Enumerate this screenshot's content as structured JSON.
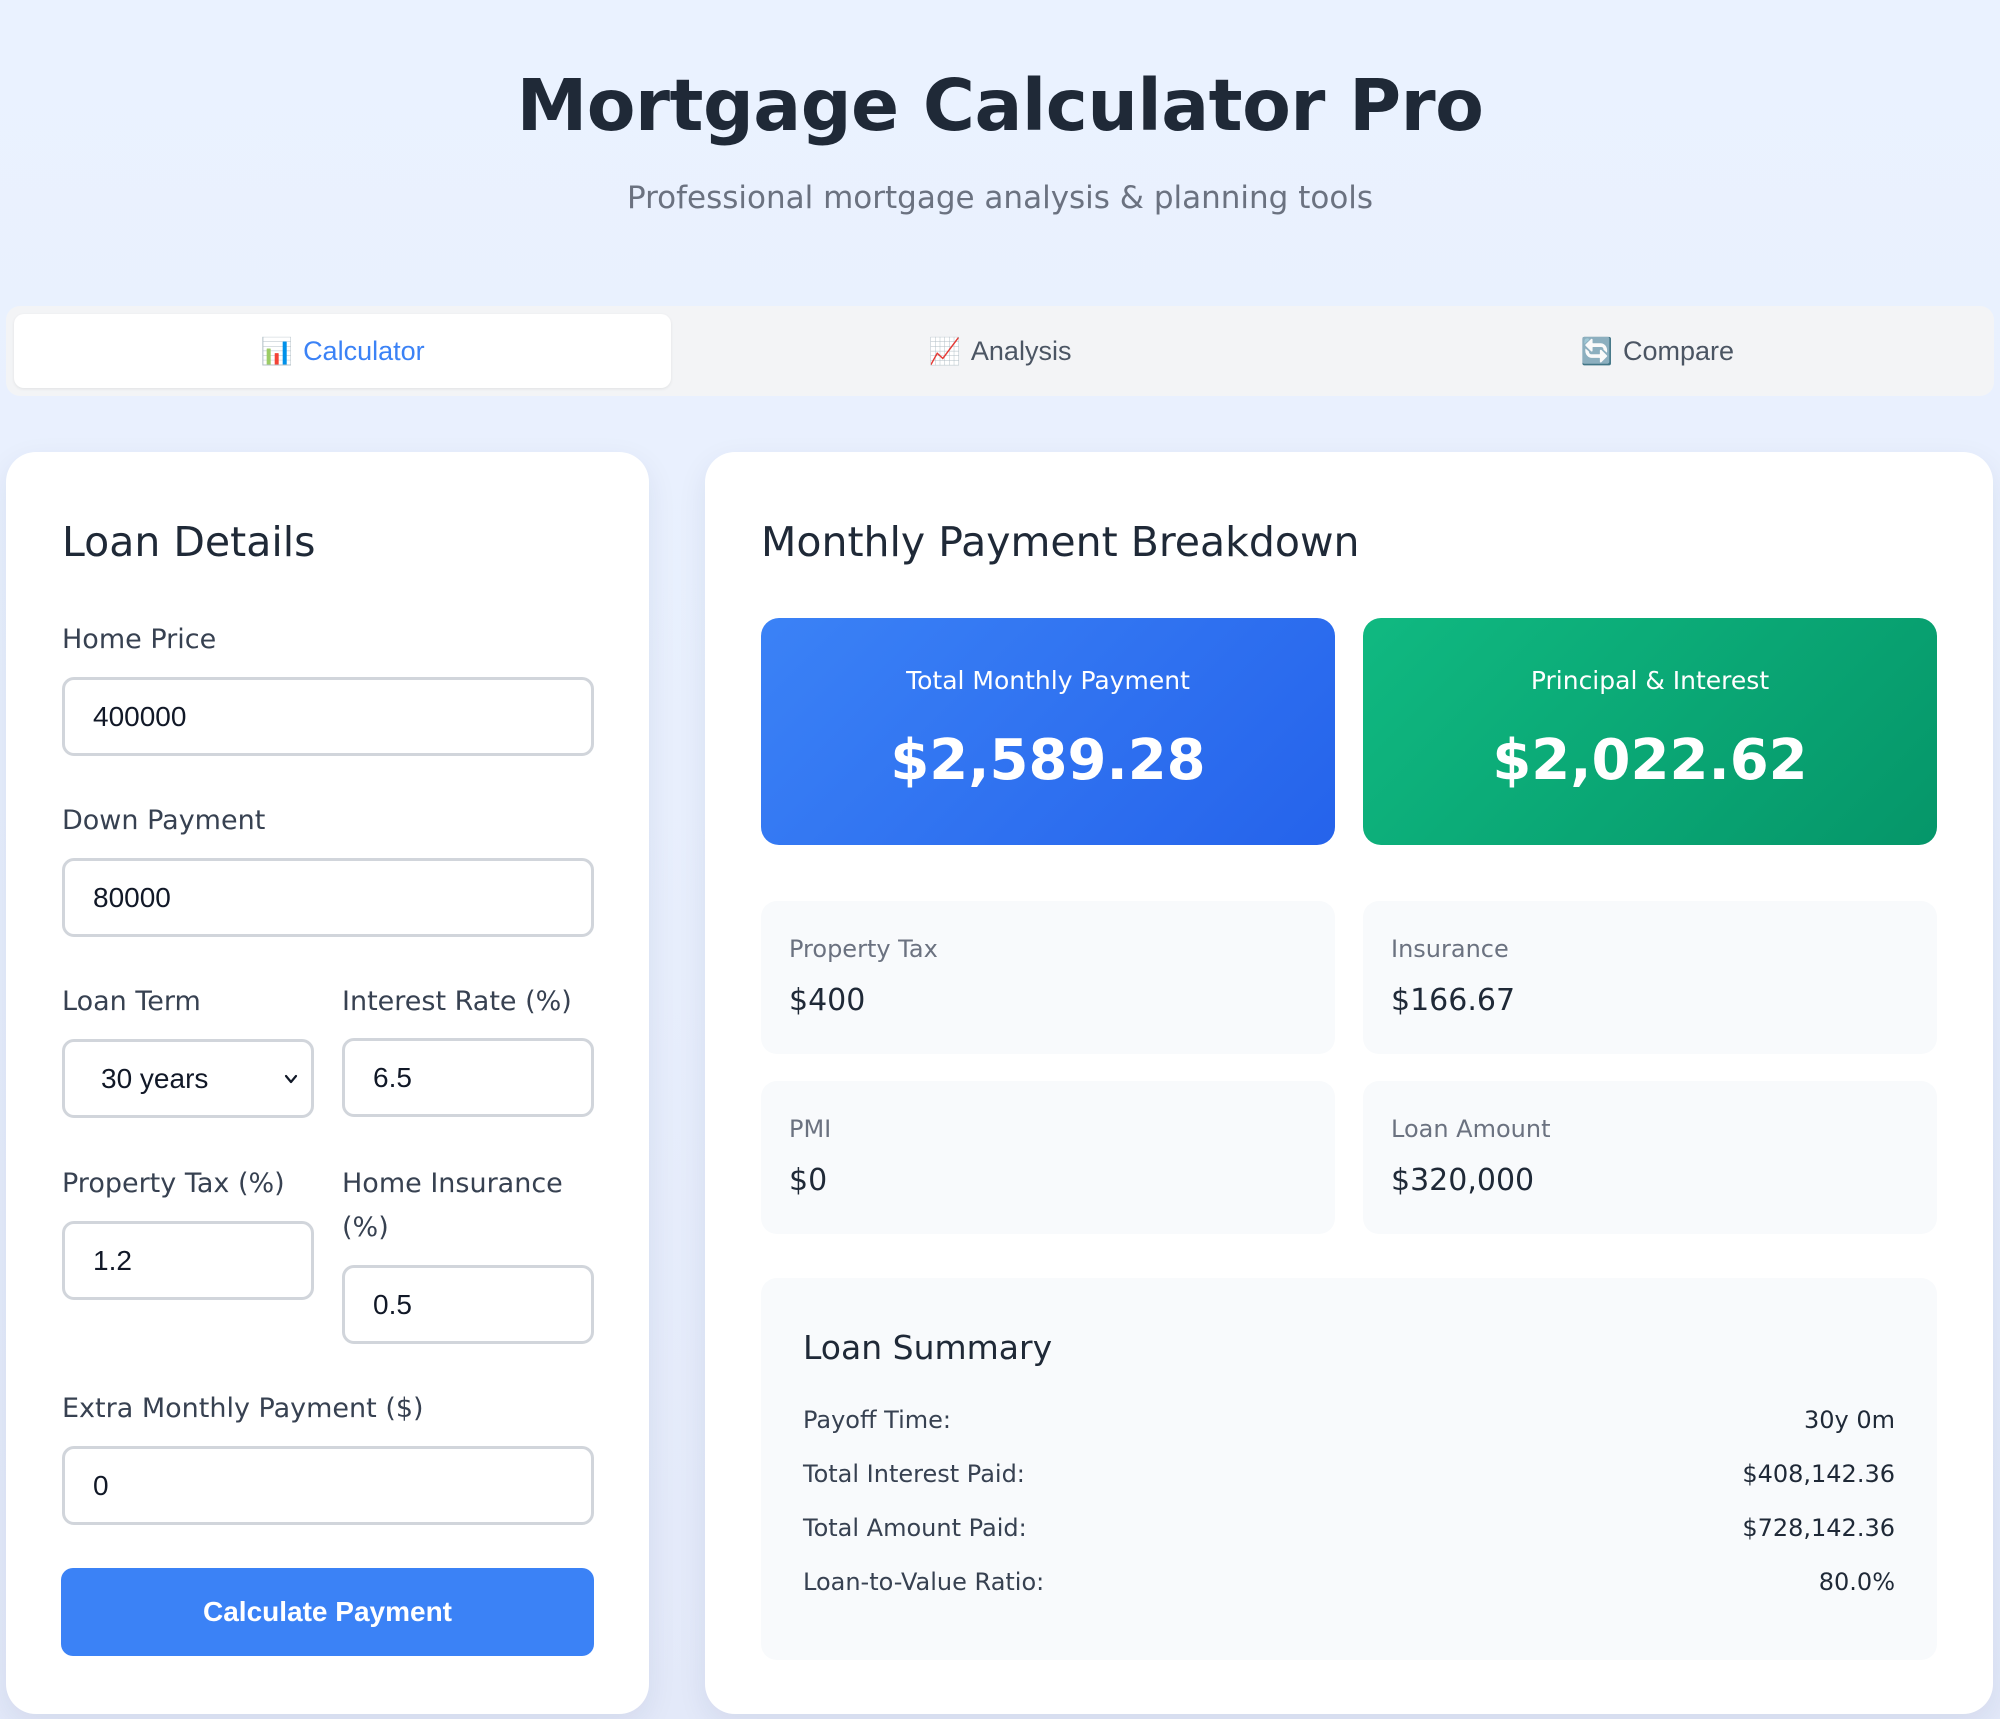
{
  "header": {
    "title": "Mortgage Calculator Pro",
    "subtitle": "Professional mortgage analysis & planning tools"
  },
  "tabs": [
    {
      "label": "Calculator",
      "icon": "bar-chart-icon",
      "glyph": "📊",
      "active": true
    },
    {
      "label": "Analysis",
      "icon": "line-chart-icon",
      "glyph": "📈",
      "active": false
    },
    {
      "label": "Compare",
      "icon": "compare-icon",
      "glyph": "🔄",
      "active": false
    }
  ],
  "loan_details": {
    "title": "Loan Details",
    "home_price": {
      "label": "Home Price",
      "value": "400000"
    },
    "down_payment": {
      "label": "Down Payment",
      "value": "80000"
    },
    "loan_term": {
      "label": "Loan Term",
      "value": "30 years"
    },
    "interest_rate": {
      "label": "Interest Rate (%)",
      "value": "6.5"
    },
    "property_tax": {
      "label": "Property Tax (%)",
      "value": "1.2"
    },
    "home_insurance": {
      "label_line1": "Home Insurance",
      "label_line2": "(%)",
      "value": "0.5"
    },
    "extra_payment": {
      "label": "Extra Monthly Payment ($)",
      "value": "0"
    },
    "calculate_label": "Calculate Payment"
  },
  "breakdown": {
    "title": "Monthly Payment Breakdown",
    "total_monthly": {
      "label": "Total Monthly Payment",
      "value": "$2,589.28"
    },
    "principal_interest": {
      "label": "Principal & Interest",
      "value": "$2,022.62"
    },
    "property_tax": {
      "label": "Property Tax",
      "value": "$400"
    },
    "insurance": {
      "label": "Insurance",
      "value": "$166.67"
    },
    "pmi": {
      "label": "PMI",
      "value": "$0"
    },
    "loan_amount": {
      "label": "Loan Amount",
      "value": "$320,000"
    }
  },
  "summary": {
    "title": "Loan Summary",
    "rows": [
      {
        "label": "Payoff Time:",
        "value": "30y 0m"
      },
      {
        "label": "Total Interest Paid:",
        "value": "$408,142.36"
      },
      {
        "label": "Total Amount Paid:",
        "value": "$728,142.36"
      },
      {
        "label": "Loan-to-Value Ratio:",
        "value": "80.0%"
      }
    ]
  },
  "colors": {
    "accent": "#3b82f6",
    "green": "#10b981",
    "text": "#1f2937"
  }
}
